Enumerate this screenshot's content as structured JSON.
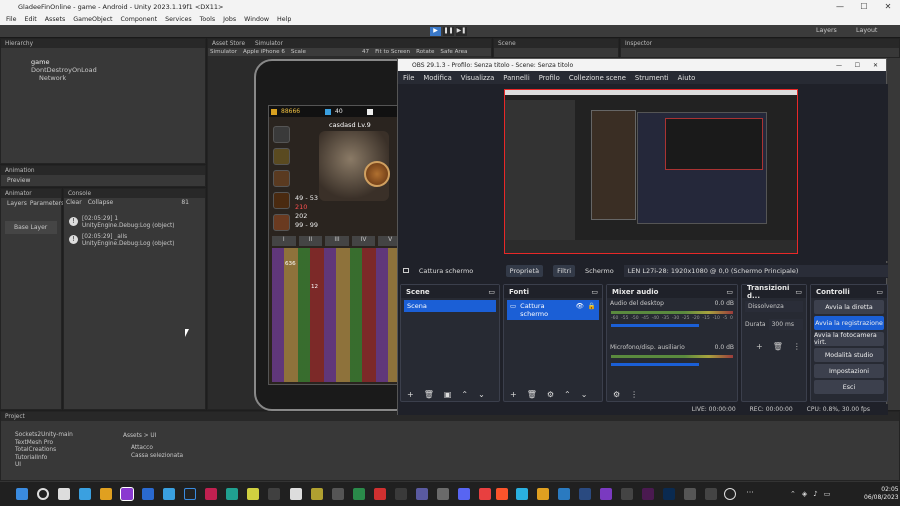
{
  "unity": {
    "title": "GladeeFinOnline - game - Android - Unity 2023.1.19f1 <DX11>",
    "menu": [
      "File",
      "Edit",
      "Assets",
      "GameObject",
      "Component",
      "Services",
      "Tools",
      "Jobs",
      "Window",
      "Help"
    ],
    "layers": "Layers",
    "layout": "Layout",
    "hierarchy_tab": "Hierarchy",
    "hierarchy_items": [
      "game",
      "DontDestroyOnLoad",
      "Network"
    ],
    "animation_tab": "Animation",
    "preview": "Preview",
    "animator_tab": "Animator",
    "console_tab": "Console",
    "animator_sub": [
      "Layers",
      "Parameters"
    ],
    "base_layer": "Base Layer",
    "console_bar": [
      "Clear",
      "Collapse"
    ],
    "console_count": "81",
    "console_logs": [
      {
        "time": "[02:05:29] 1",
        "detail": "UnityEngine.Debug:Log (object)"
      },
      {
        "time": "[02:05:29] _alls",
        "detail": "UnityEngine.Debug:Log (object)"
      }
    ],
    "center_tabs": [
      "Asset Store",
      "Simulator"
    ],
    "sim_bar": [
      "Simulator",
      "Apple iPhone 6",
      "Scale",
      "47",
      "Fit to Screen",
      "Rotate",
      "Safe Area"
    ],
    "scene_tab": "Scene",
    "inspector_tab": "Inspector",
    "project_tab": "Project",
    "project_items": [
      "Sockets2Unity-main",
      "TextMesh Pro",
      "TotalCreations",
      "TutorialInfo",
      "UI"
    ],
    "breadcrumb": "Assets > UI",
    "assets": [
      "Attacco",
      "Cassa selezionata"
    ]
  },
  "game": {
    "gold": "88666",
    "gems": "40",
    "char_name": "casdasd Lv.9",
    "stats": [
      "49 - 53",
      "210",
      "202",
      "99 - 99"
    ],
    "tabs": [
      "I",
      "II",
      "III",
      "IV",
      "V"
    ],
    "counts": [
      "636",
      "12"
    ]
  },
  "obs": {
    "title": "OBS 29.1.3 - Profilo: Senza titolo - Scene: Senza titolo",
    "menu": [
      "File",
      "Modifica",
      "Visualizza",
      "Pannelli",
      "Profilo",
      "Collezione scene",
      "Strumenti",
      "Aiuto"
    ],
    "source_label": "Cattura schermo",
    "props": "Proprietà",
    "filters": "Filtri",
    "screen_label": "Schermo",
    "screen_value": "LEN L27i-28: 1920x1080 @ 0,0 (Schermo Principale)",
    "scenes": {
      "header": "Scene",
      "items": [
        "Scena"
      ]
    },
    "sources": {
      "header": "Fonti",
      "items": [
        "Cattura schermo"
      ]
    },
    "mixer": {
      "header": "Mixer audio",
      "channels": [
        {
          "name": "Audio del desktop",
          "db": "0.0 dB"
        },
        {
          "name": "Microfono/disp. ausiliario",
          "db": "0.0 dB"
        }
      ],
      "scale": [
        "-60",
        "-55",
        "-50",
        "-45",
        "-40",
        "-35",
        "-30",
        "-25",
        "-20",
        "-15",
        "-10",
        "-5",
        "0"
      ]
    },
    "transitions": {
      "header": "Transizioni d...",
      "type": "Dissolvenza",
      "duration_label": "Durata",
      "duration": "300 ms"
    },
    "controls": {
      "header": "Controlli",
      "buttons": [
        "Avvia la diretta",
        "Avvia la registrazione",
        "Avvia la fotocamera virt.",
        "Modalità studio",
        "Impostazioni",
        "Esci"
      ]
    },
    "status": {
      "live": "LIVE: 00:00:00",
      "rec": "REC: 00:00:00",
      "cpu": "CPU: 0.8%, 30.00 fps"
    }
  },
  "taskbar": {
    "time": "02:05",
    "date": "06/08/2023"
  },
  "colors": {
    "obs_accent": "#1b5fd6",
    "rec_border": "#e82828",
    "unity_play": "#3a78c8"
  }
}
